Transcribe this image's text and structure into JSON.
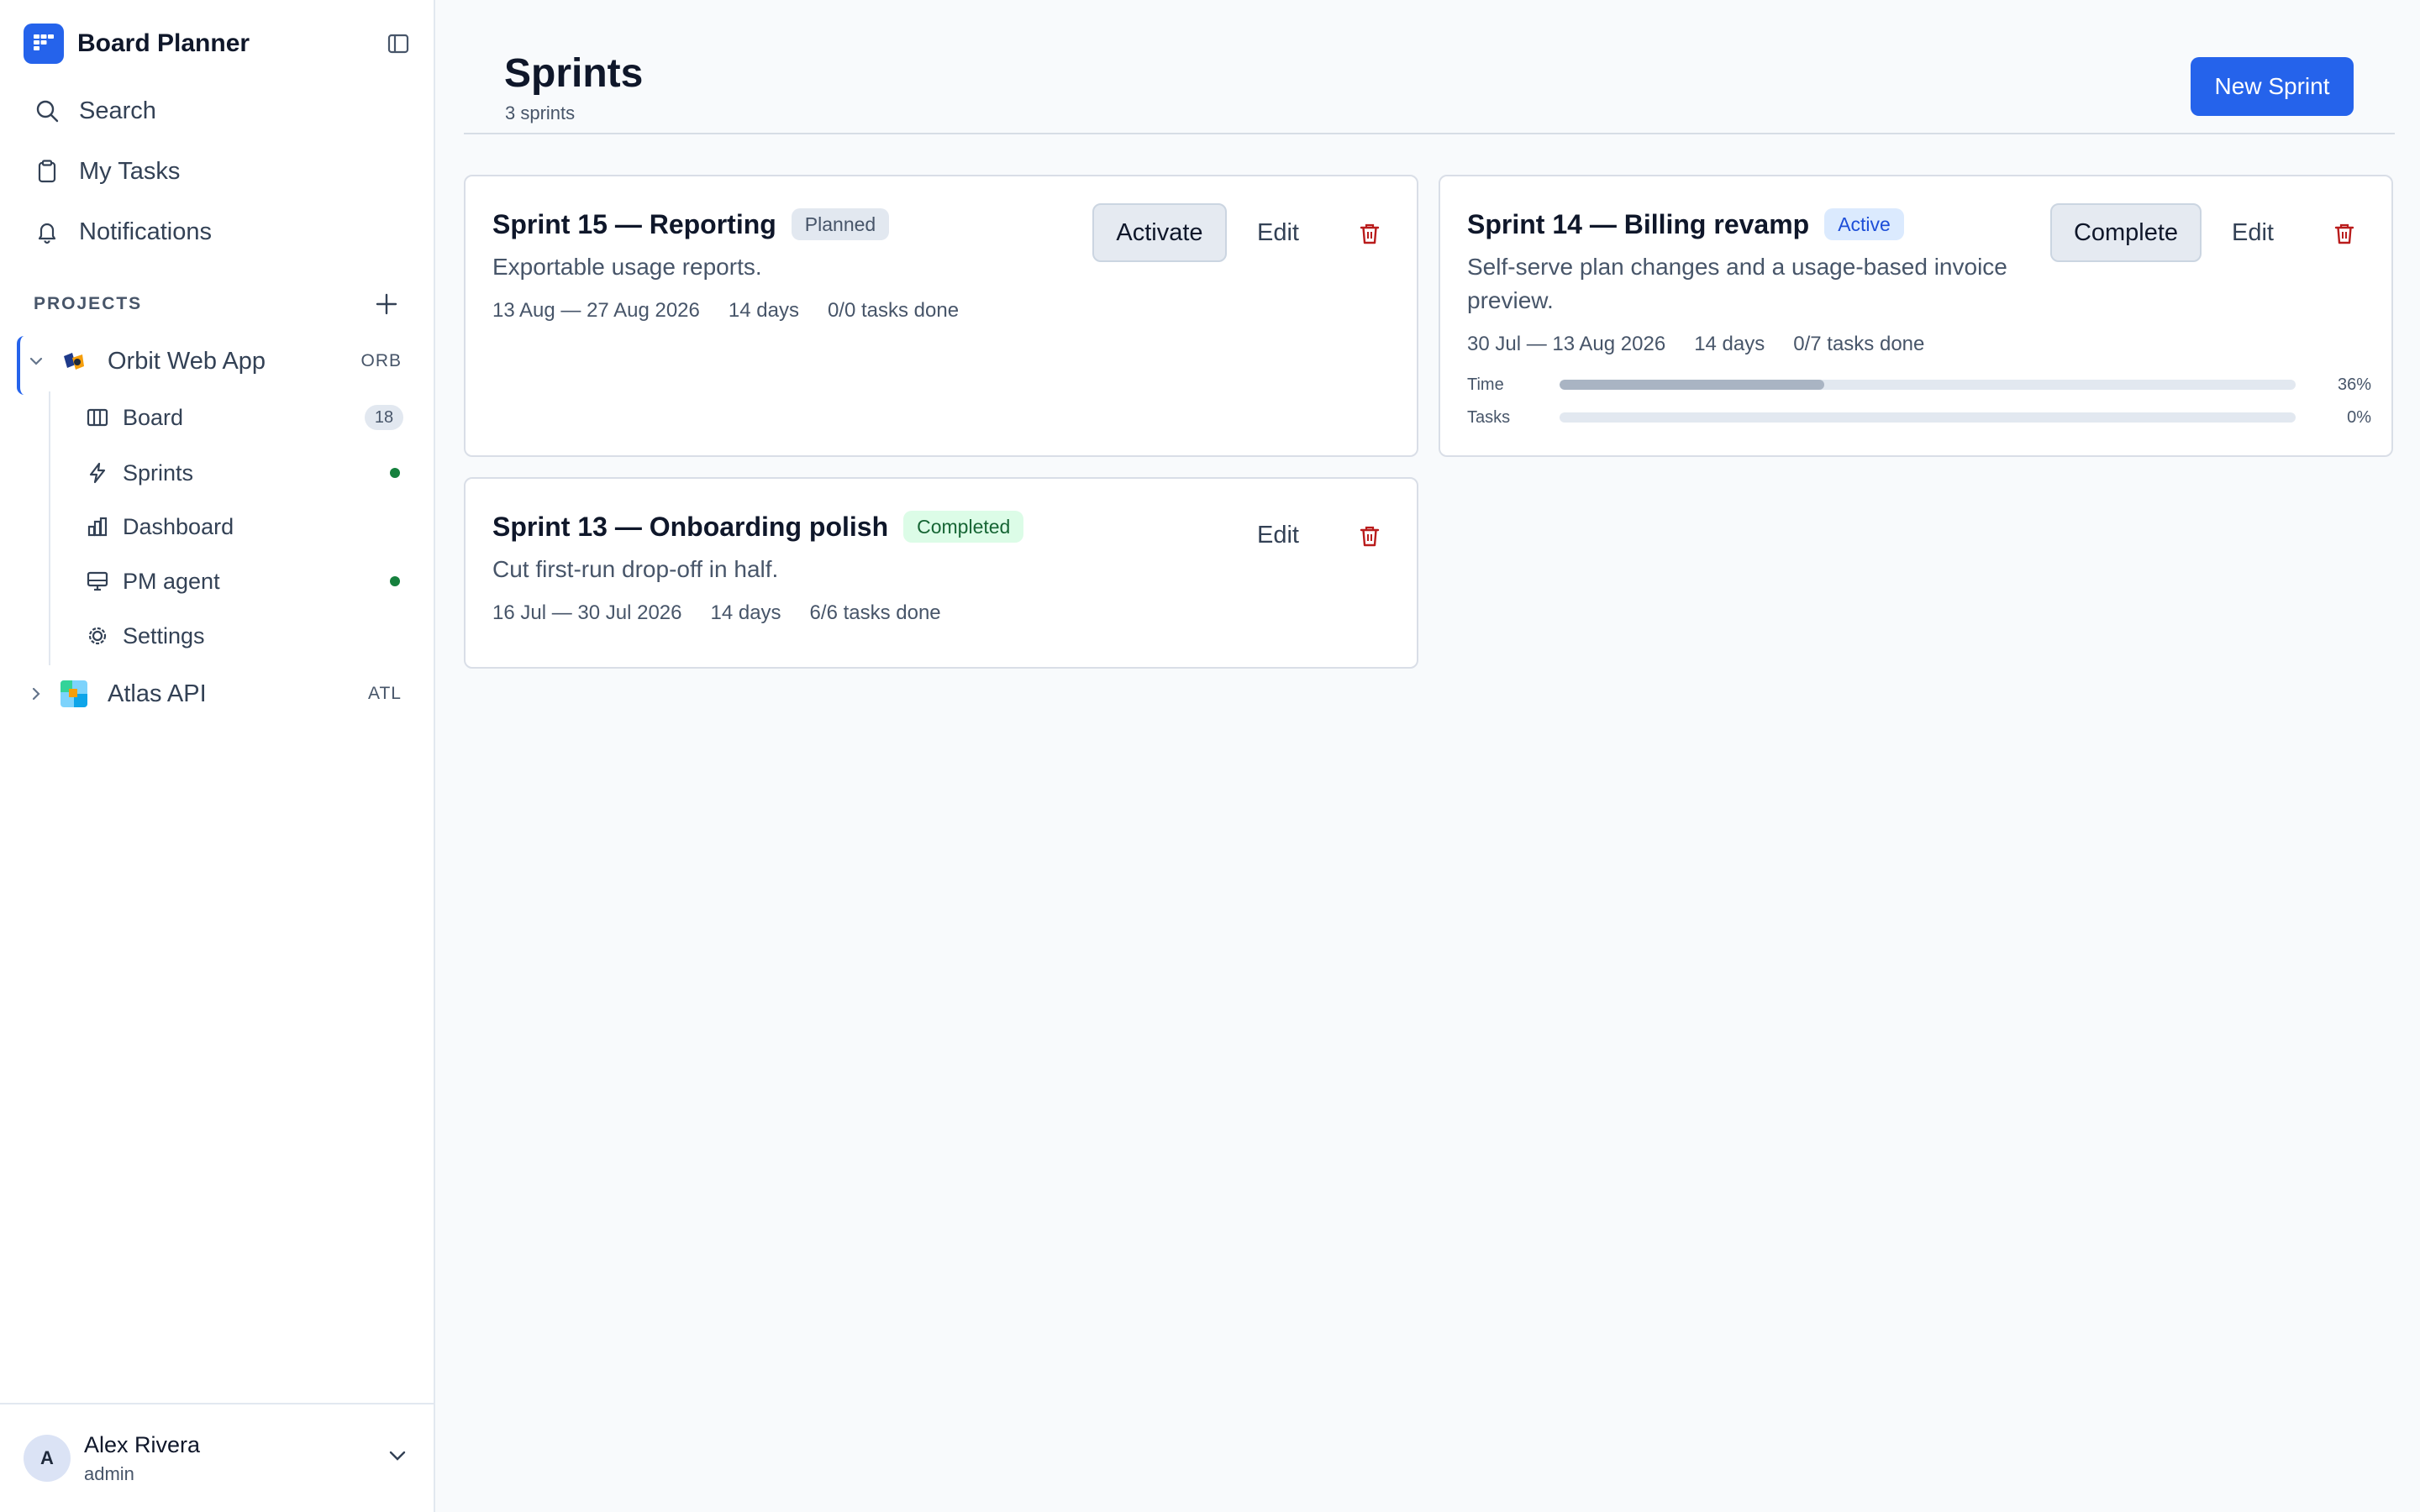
{
  "app": {
    "title": "Board Planner"
  },
  "nav": {
    "search": "Search",
    "my_tasks": "My Tasks",
    "notifications": "Notifications"
  },
  "projects": {
    "section_label": "PROJECTS",
    "items": [
      {
        "name": "Orbit Web App",
        "key": "ORB",
        "expanded": true,
        "children": [
          {
            "label": "Board",
            "count": "18"
          },
          {
            "label": "Sprints",
            "status": "dot"
          },
          {
            "label": "Dashboard"
          },
          {
            "label": "PM agent",
            "status": "dot"
          },
          {
            "label": "Settings"
          }
        ]
      },
      {
        "name": "Atlas API",
        "key": "ATL",
        "expanded": false
      }
    ]
  },
  "user": {
    "name": "Alex Rivera",
    "role": "admin",
    "initial": "A"
  },
  "page": {
    "title": "Sprints",
    "subtitle": "3 sprints",
    "new_button": "New Sprint"
  },
  "sprints": [
    {
      "title": "Sprint 15 — Reporting",
      "status": "Planned",
      "description": "Exportable usage reports.",
      "dates": "13 Aug — 27 Aug 2026",
      "duration": "14 days",
      "tasks": "0/0 tasks done",
      "primary_action": "Activate",
      "edit": "Edit"
    },
    {
      "title": "Sprint 14 — Billing revamp",
      "status": "Active",
      "description": "Self-serve plan changes and a usage-based invoice preview.",
      "dates": "30 Jul — 13 Aug 2026",
      "duration": "14 days",
      "tasks": "0/7 tasks done",
      "primary_action": "Complete",
      "edit": "Edit",
      "progress": [
        {
          "label": "Time",
          "value": "36%",
          "fraction": 0.36
        },
        {
          "label": "Tasks",
          "value": "0%",
          "fraction": 0
        }
      ]
    },
    {
      "title": "Sprint 13 — Onboarding polish",
      "status": "Completed",
      "description": "Cut first-run drop-off in half.",
      "dates": "16 Jul — 30 Jul 2026",
      "duration": "14 days",
      "tasks": "6/6 tasks done",
      "edit": "Edit"
    }
  ],
  "colors": {
    "accent": "#2563eb",
    "danger": "#b91c1c",
    "status_dot": "#15803d"
  }
}
